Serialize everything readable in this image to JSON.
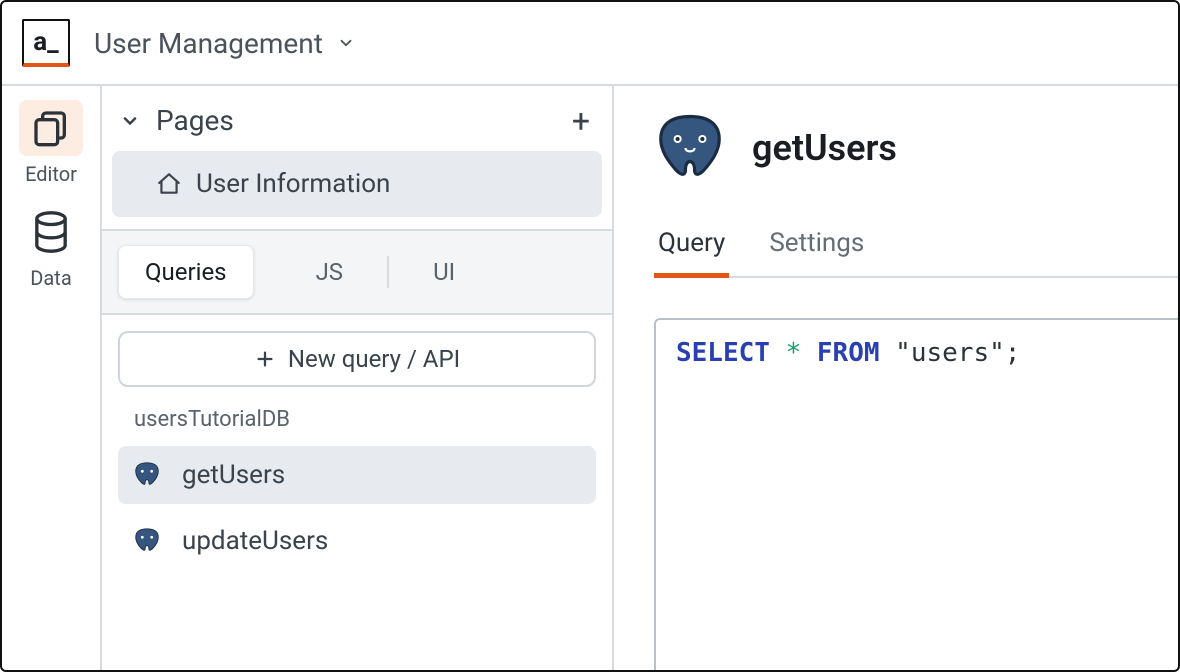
{
  "header": {
    "logo_text": "a_",
    "app_name": "User Management"
  },
  "rail": {
    "items": [
      {
        "id": "editor",
        "label": "Editor",
        "active": true
      },
      {
        "id": "data",
        "label": "Data",
        "active": false
      }
    ]
  },
  "sidebar": {
    "pages_section": {
      "title": "Pages",
      "pages": [
        {
          "name": "User Information",
          "active": true
        }
      ]
    },
    "tabs": [
      {
        "id": "queries",
        "label": "Queries",
        "active": true
      },
      {
        "id": "js",
        "label": "JS",
        "active": false
      },
      {
        "id": "ui",
        "label": "UI",
        "active": false
      }
    ],
    "new_query_label": "New query / API",
    "datasource_label": "usersTutorialDB",
    "queries": [
      {
        "name": "getUsers",
        "active": true
      },
      {
        "name": "updateUsers",
        "active": false
      }
    ]
  },
  "main": {
    "title": "getUsers",
    "tabs": [
      {
        "id": "query",
        "label": "Query",
        "active": true
      },
      {
        "id": "settings",
        "label": "Settings",
        "active": false
      }
    ],
    "sql": {
      "kw1": "SELECT",
      "star": "*",
      "kw2": "FROM",
      "rest": "\"users\";"
    }
  }
}
